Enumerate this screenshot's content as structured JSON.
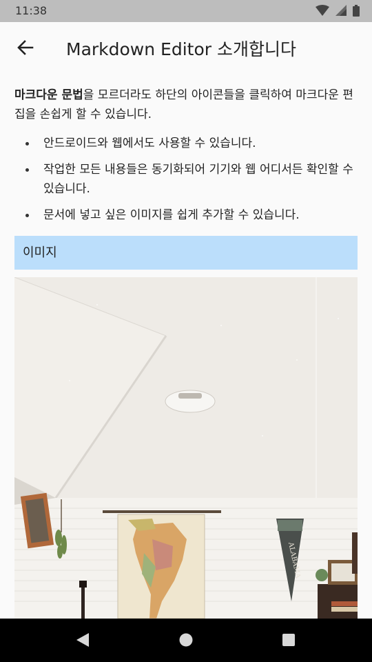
{
  "status": {
    "time": "11:38",
    "icons": [
      "wifi-icon",
      "signal-icon",
      "battery-icon"
    ]
  },
  "app_bar": {
    "back_icon": "arrow-left-icon",
    "title": "Markdown Editor 소개합니다"
  },
  "content": {
    "intro_bold": "마크다운 문법",
    "intro_rest": "을 모르더라도 하단의 아이콘들을 클릭하여 마크다운 편집을 손쉽게 할 수 있습니다.",
    "bullets": [
      "안드로이드와 웹에서도 사용할 수 있습니다.",
      "작업한 모든 내용들은 동기화되어  기기와 웹 어디서든 확인할 수 있습니다.",
      "문서에 넣고 싶은 이미지를 쉽게 추가할 수 있습니다."
    ],
    "image_header": "이미지",
    "photo": {
      "pennant_text": "ALABAMA"
    }
  },
  "nav": {
    "back": "nav-back-icon",
    "home": "nav-home-icon",
    "recents": "nav-recents-icon"
  },
  "colors": {
    "status_bar": "#bdbdbd",
    "image_header_bg": "#bbdefb",
    "nav_bar": "#000000"
  }
}
